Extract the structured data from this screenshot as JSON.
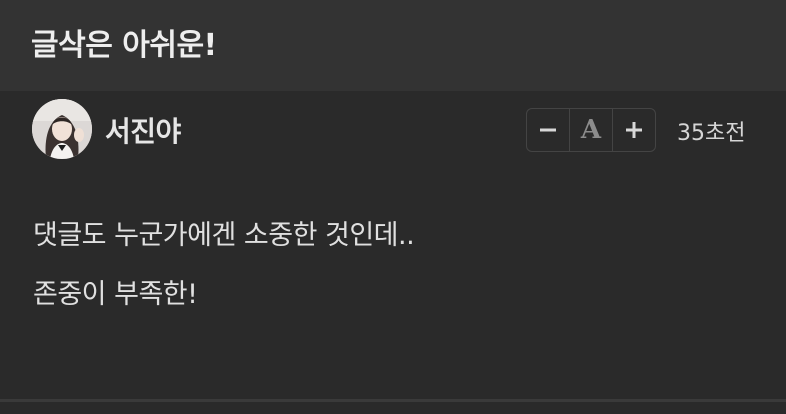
{
  "post": {
    "title": "글삭은 아쉬운!"
  },
  "author": {
    "name": "서진야",
    "avatar": "avatar-photo",
    "timestamp": "35초전"
  },
  "font_controls": {
    "decrease_icon": "minus-icon",
    "font_icon": "font-size-icon",
    "font_glyph": "A",
    "increase_icon": "plus-icon"
  },
  "comment": {
    "lines": [
      "댓글도 누군가에겐 소중한 것인데..",
      "존중이 부족한!"
    ]
  },
  "colors": {
    "header_bg": "#333333",
    "page_bg": "#2a2a2a",
    "text": "#e0e0e0",
    "muted_icon": "#8c8c8c"
  }
}
